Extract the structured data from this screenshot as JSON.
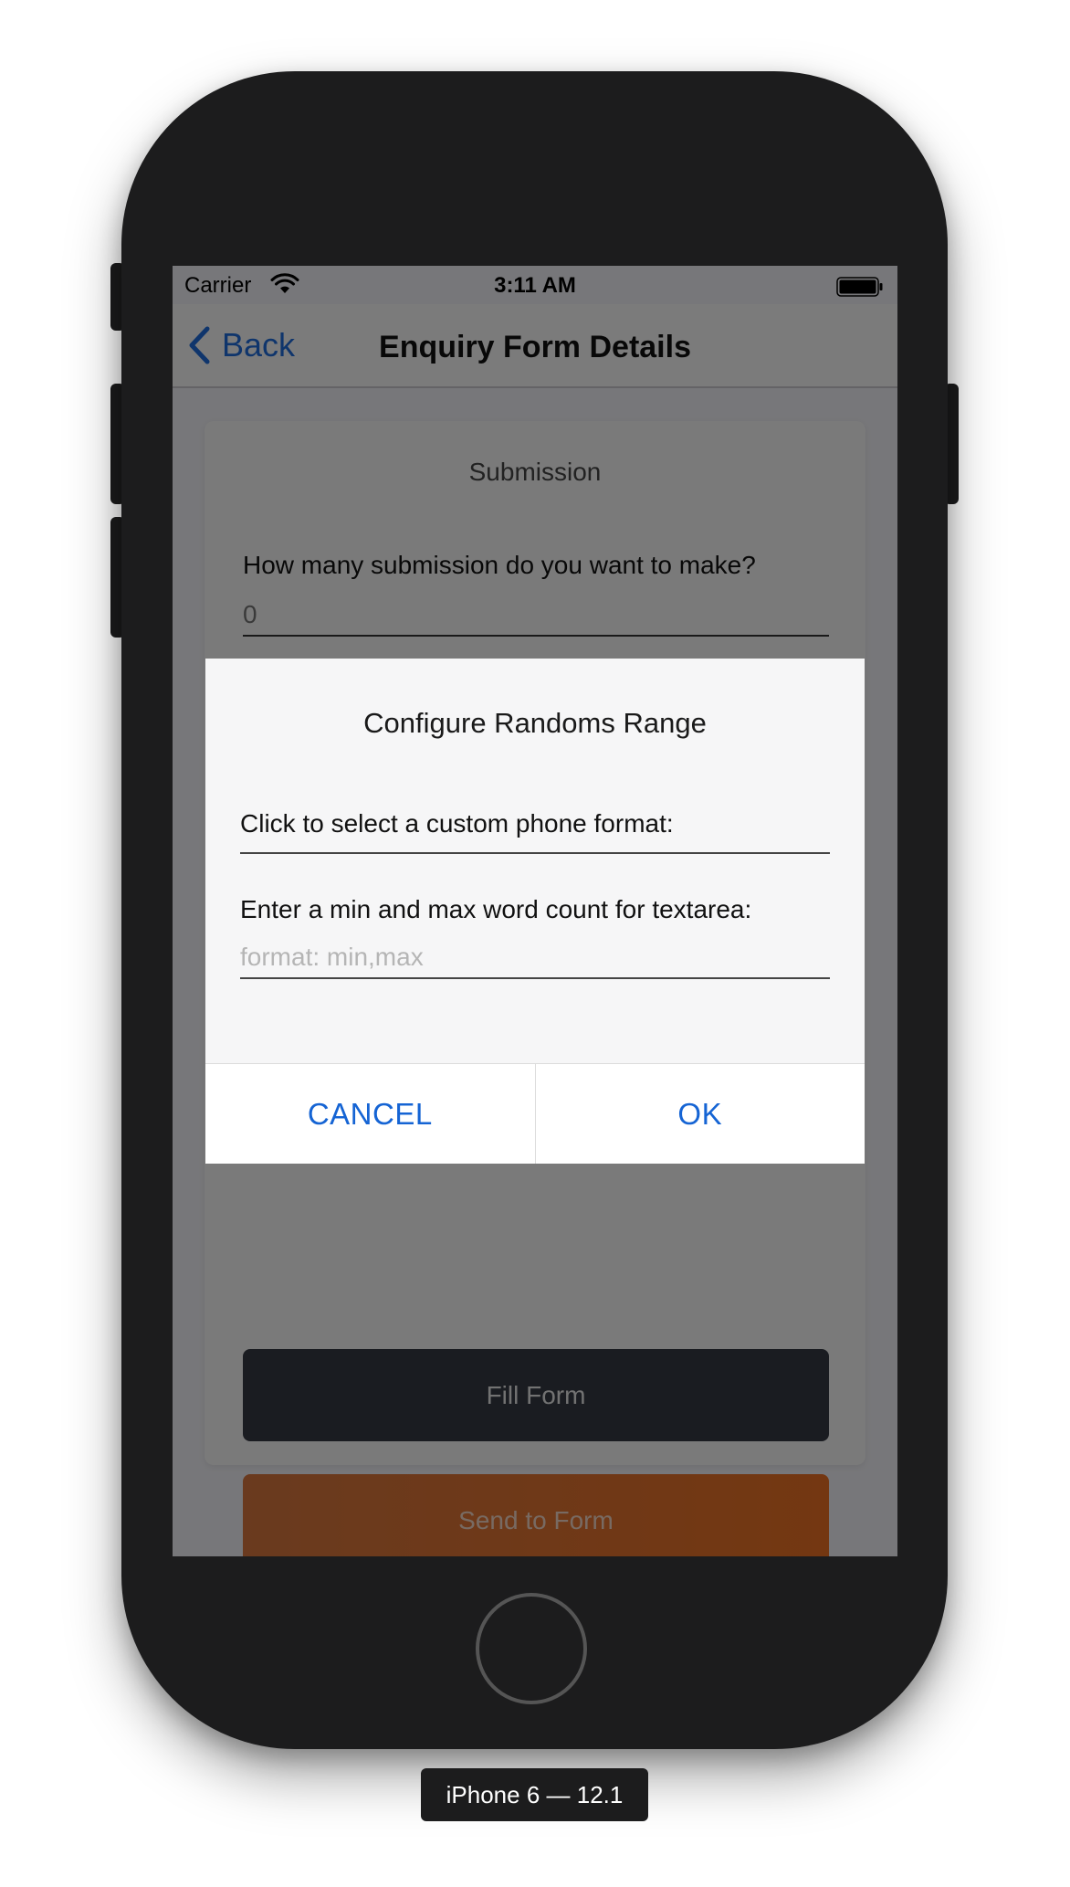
{
  "status_bar": {
    "carrier": "Carrier",
    "time": "3:11 AM",
    "wifi_icon": "wifi-icon",
    "battery_icon": "battery-icon"
  },
  "nav": {
    "back_label": "Back",
    "title": "Enquiry Form Details"
  },
  "form": {
    "section_title": "Submission",
    "question": "How many submission do you want to make?",
    "count_placeholder": "0",
    "fill_button": "Fill Form",
    "send_button": "Send to Form"
  },
  "dialog": {
    "title": "Configure Randoms Range",
    "phone_format_label": "Click to select a custom phone format:",
    "word_count_label": "Enter a min and max word count for textarea:",
    "word_count_placeholder": "format: min,max",
    "cancel_label": "CANCEL",
    "ok_label": "OK"
  },
  "device": {
    "label": "iPhone 6 — 12.1"
  },
  "colors": {
    "accent_blue": "#1564d4",
    "fill_button": "#353943",
    "send_button": "#e86f23",
    "phone_frame": "#1c1c1d"
  }
}
